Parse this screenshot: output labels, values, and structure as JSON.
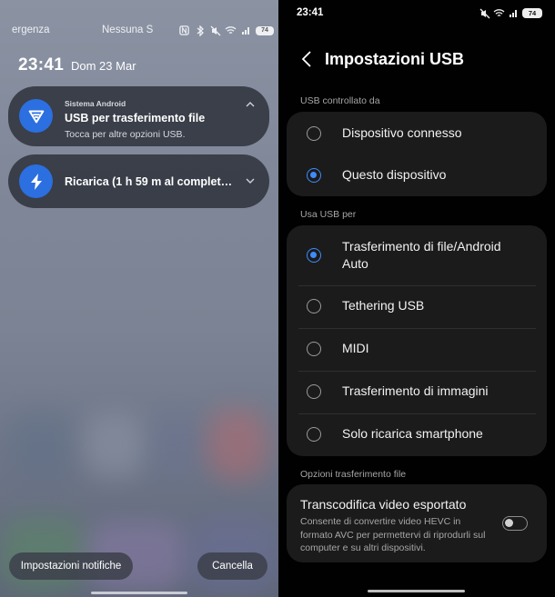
{
  "left_panel": {
    "status": {
      "carrier_left": "ergenza",
      "carrier_right": "Nessuna S",
      "battery": "74",
      "icons": [
        "nfc-icon",
        "bluetooth-icon",
        "mute-icon",
        "wifi-icon",
        "signal-icon",
        "battery-icon"
      ]
    },
    "clock": {
      "time": "23:41",
      "date": "Dom 23 Mar"
    },
    "notifications": [
      {
        "app": "Sistema Android",
        "title": "USB per trasferimento file",
        "text": "Tocca per altre opzioni USB.",
        "icon": "android-system-icon",
        "expanded": true
      },
      {
        "app": "",
        "title": "Ricarica (1 h 59 m al completam...",
        "text": "",
        "icon": "charging-bolt-icon",
        "expanded": false
      }
    ],
    "buttons": {
      "notification_settings": "Impostazioni notifiche",
      "cancel": "Cancella"
    }
  },
  "right_panel": {
    "status": {
      "time": "23:41",
      "battery": "74"
    },
    "title": "Impostazioni USB",
    "sections": {
      "controlled_by": {
        "label": "USB controllato da",
        "options": [
          {
            "label": "Dispositivo connesso",
            "selected": false
          },
          {
            "label": "Questo dispositivo",
            "selected": true
          }
        ]
      },
      "use_usb_for": {
        "label": "Usa USB per",
        "options": [
          {
            "label": "Trasferimento di file/Android Auto",
            "selected": true
          },
          {
            "label": "Tethering USB",
            "selected": false
          },
          {
            "label": "MIDI",
            "selected": false
          },
          {
            "label": "Trasferimento di immagini",
            "selected": false
          },
          {
            "label": "Solo ricarica smartphone",
            "selected": false
          }
        ]
      },
      "file_transfer_options": {
        "label": "Opzioni trasferimento file",
        "toggle_title": "Transcodifica video esportato",
        "toggle_desc": "Consente di convertire video HEVC in formato AVC per permettervi di riprodurli sul computer e su altri dispositivi.",
        "toggle_on": false
      }
    },
    "colors": {
      "accent": "#3e8bff",
      "card": "#1b1b1b",
      "background": "#010101"
    }
  }
}
